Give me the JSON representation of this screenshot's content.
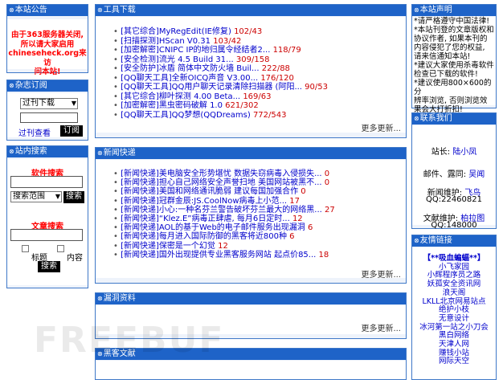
{
  "left": {
    "notice": {
      "title": "本站公告",
      "lines": [
        "由于363服务器关闭,",
        "所以请大家启用",
        "chineseheck.org来访",
        "问本站!"
      ]
    },
    "magazine": {
      "title": "杂志订阅",
      "select": "过刊下载",
      "link": "过刊查看",
      "button": "订阅"
    },
    "search": {
      "title": "站内搜索",
      "soft_label": "软件搜索",
      "scope_select": "搜索范围",
      "soft_button": "搜索",
      "article_label": "文章搜索",
      "title_opt": "标题",
      "content_opt": "内容",
      "article_button": "搜索"
    }
  },
  "tools": {
    "title": "工具下载",
    "items": [
      {
        "cat": "[其它综合]",
        "title": "MyRegEdit(IE修复)",
        "count": "102/43"
      },
      {
        "cat": "[扫描探测]",
        "title": "HScan V0.31",
        "count": "103/42"
      },
      {
        "cat": "[加密解密]",
        "title": "CNIPC IP的地归属令经结者2...",
        "count": "118/79"
      },
      {
        "cat": "[安全检测]",
        "title": "流光 4.5 Build 31...",
        "count": "309/158"
      },
      {
        "cat": "[安全防护]",
        "title": "冰盾 简体中文防火墙 Buil...",
        "count": "222/88"
      },
      {
        "cat": "[QQ聊天工具]",
        "title": "全新OICQ声音 V3.00...",
        "count": "176/120"
      },
      {
        "cat": "[QQ聊天工具]",
        "title": "QQ用户聊天记录清除扫描器 (阿阳...",
        "count": "90/53"
      },
      {
        "cat": "[其它综合]",
        "title": "柳叶探测 4.00 Beta...",
        "count": "169/63"
      },
      {
        "cat": "[加密解密]",
        "title": "黑虫密码破解 1.0",
        "count": "621/302"
      },
      {
        "cat": "[QQ聊天工具]",
        "title": "QQ梦想(QQDreams)",
        "count": "772/543"
      }
    ],
    "more": "更多更新..."
  },
  "news": {
    "title": "新闻快递",
    "items": [
      {
        "cat": "[新闻快递]",
        "title": "美电脑安全形势堪忧 数据失窃病毒入侵损失...",
        "count": "0"
      },
      {
        "cat": "[新闻快递]",
        "title": "担心自己网络安全声誉扫地 美国网站被黑不...",
        "count": "0"
      },
      {
        "cat": "[新闻快递]",
        "title": "美国和网络通讯脆弱 建议每国加强合作",
        "count": "0"
      },
      {
        "cat": "[新闻快递]",
        "title": "冠群金辰:JS.CoolNow病毒上小范...",
        "count": "17"
      },
      {
        "cat": "[新闻快递]",
        "title": "小心:一种名芬兰警告破坏芬兰最大的网络黑...",
        "count": "27"
      },
      {
        "cat": "[新闻快递]",
        "title": "“Klez.E”病毒正肆虐, 每月6日定时...",
        "count": "12"
      },
      {
        "cat": "[新闻快递]",
        "title": "AOL的基于Web的电子邮件服务出现漏洞",
        "count": "6"
      },
      {
        "cat": "[新闻快递]",
        "title": "每月进入国际防御的黑客将近800种",
        "count": "6"
      },
      {
        "cat": "[新闻快递]",
        "title": "保密是一个幻觉",
        "count": "12"
      },
      {
        "cat": "[新闻快递]",
        "title": "国外出现提供专业黑客服务网站 起点价85...",
        "count": "18"
      }
    ],
    "more": "更多更新..."
  },
  "vuln": {
    "title": "漏洞资料",
    "more": "更多更新..."
  },
  "hacker": {
    "title": "黑客文献"
  },
  "right": {
    "statement": {
      "title": "本站声明",
      "lines": [
        "*请严格遵守中国法律!",
        "*本站刊登的文章版权和",
        "协议作者, 如果本刊的",
        "内容侵犯了您的权益,",
        "请来信通知本站!",
        "*建议大家使用杀毒软件",
        "检查已下载的软件!",
        "*建议使用800×600的分",
        "辨率浏览, 否则浏览效",
        "果会大打折扣!"
      ]
    },
    "contact": {
      "title": "联系我们",
      "master_label": "站长:",
      "master": "陆小凤",
      "mail_label": "邮件、露同:",
      "mail": "吴闻",
      "news_label": "新闻维护:",
      "news": "飞鸟",
      "qq1": "QQ:22460821",
      "doc_label": "文献维护:",
      "doc": "柏拉图",
      "qq2": "QQ:148000"
    },
    "links": {
      "title": "友情链接",
      "items": [
        "【**吸血蝙蝠**】",
        "小飞家园",
        "小辉程序员之路",
        "妖孤安全资讯网",
        "浪天阁",
        "LKLL北京网易站点",
        "绝护小枝",
        "无意设计",
        "冰河第一站之小刀会",
        "黑白网络",
        "天津人网",
        "赚钱小站",
        "网际天空"
      ]
    }
  },
  "watermark": "FREEBUF",
  "colors": {
    "header": "#1e63c8",
    "border": "#3f78c8",
    "panel_bg": "#eef3fb",
    "accent_red": "#cc0000"
  }
}
